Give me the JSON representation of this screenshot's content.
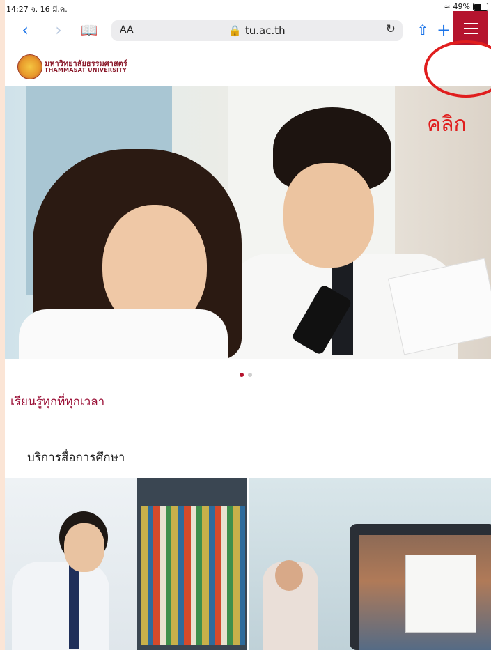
{
  "status_bar": {
    "time": "14:27  จ. 16 มี.ค.",
    "battery": "49%",
    "battery_level": 0.49
  },
  "browser": {
    "back_icon": "chevron-left-icon",
    "forward_icon": "chevron-right-icon",
    "bookmarks_icon": "book-icon",
    "reader_label": "AA",
    "url": "tu.ac.th",
    "reload_icon": "reload-icon",
    "share_icon": "share-icon",
    "new_tab_icon": "plus-icon",
    "tabs_icon": "tabs-icon"
  },
  "site": {
    "logo_th": "มหาวิทยาลัยธรรมศาสตร์",
    "logo_en": "THAMMASAT UNIVERSITY",
    "menu_icon": "hamburger-menu-icon",
    "brand_color": "#b5142e"
  },
  "annotation": {
    "click_label": "คลิก",
    "color": "#e01e1e"
  },
  "hero": {
    "slides": 2,
    "active_slide": 1
  },
  "tagline": "เรียนรู้ทุกที่ทุกเวลา",
  "section": {
    "title": "บริการสื่อการศึกษา"
  }
}
